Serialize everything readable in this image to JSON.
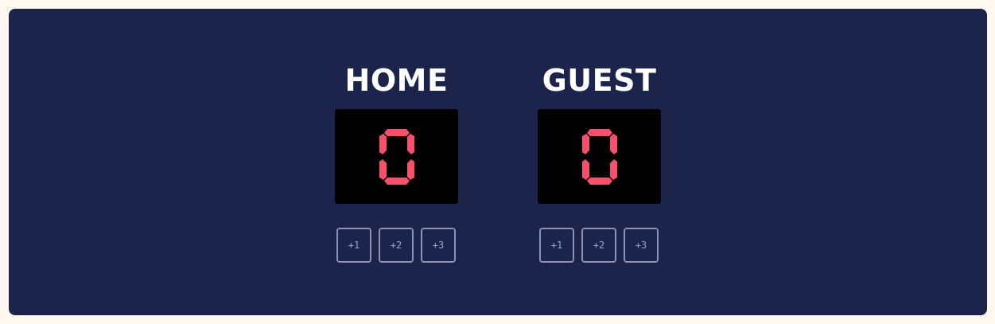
{
  "home": {
    "title": "HOME",
    "score": "0",
    "buttons": [
      "+1",
      "+2",
      "+3"
    ]
  },
  "guest": {
    "title": "GUEST",
    "score": "0",
    "buttons": [
      "+1",
      "+2",
      "+3"
    ]
  },
  "colors": {
    "board": "#1C244B",
    "page": "#FFF8EE",
    "score_segment": "#F94F6D",
    "button_border": "#8E93B5"
  }
}
